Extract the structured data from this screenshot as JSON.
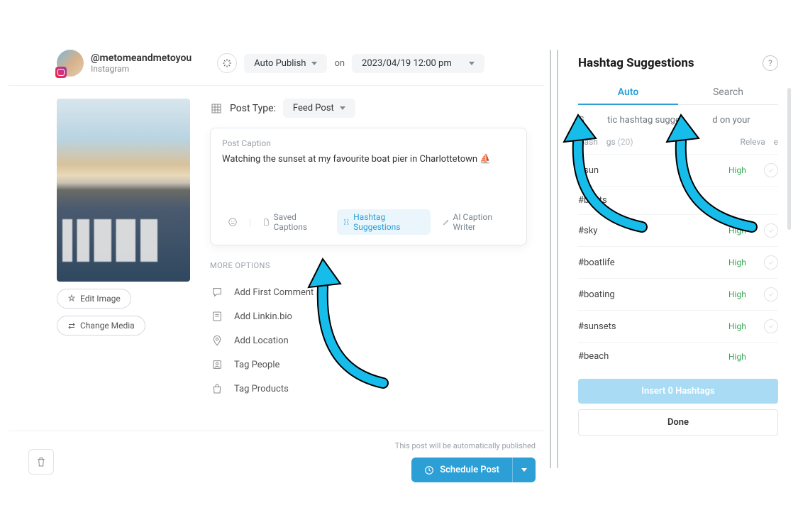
{
  "account": {
    "handle": "@metomeandmetoyou",
    "platform": "Instagram"
  },
  "publish": {
    "mode": "Auto Publish",
    "on": "on",
    "datetime": "2023/04/19 12:00 pm"
  },
  "post_type": {
    "label": "Post Type:",
    "value": "Feed Post"
  },
  "caption": {
    "label": "Post Caption",
    "text": "Watching the sunset at my favourite boat pier in Charlottetown ⛵",
    "tools": {
      "saved": "Saved Captions",
      "hashtag": "Hashtag Suggestions",
      "ai": "AI Caption Writer"
    }
  },
  "more_options_label": "MORE OPTIONS",
  "options": {
    "first_comment": "Add First Comment",
    "linkinbio": "Add Linkin.bio",
    "location": "Add Location",
    "tag_people": "Tag People",
    "tag_products": "Tag Products"
  },
  "media_actions": {
    "edit": "Edit Image",
    "change": "Change Media"
  },
  "footer": {
    "auto_note": "This post will be automatically published",
    "schedule": "Schedule Post"
  },
  "panel": {
    "title": "Hashtag Suggestions",
    "tabs": {
      "auto": "Auto",
      "search": "Search"
    },
    "hint_prefix": "G",
    "hint_mid": "tic hashtag sugges",
    "hint_suffix": "d on your",
    "header": {
      "hashtags": "Hash",
      "hashtags2": "gs",
      "count": "(20)",
      "relevance": "Releva",
      "relevance2": "e"
    },
    "rows": [
      {
        "tag": "#sun",
        "rel": "High",
        "check": true
      },
      {
        "tag": "#boats",
        "rel": "",
        "check": false
      },
      {
        "tag": "#sky",
        "rel": "High",
        "check": true
      },
      {
        "tag": "#boatlife",
        "rel": "High",
        "check": true
      },
      {
        "tag": "#boating",
        "rel": "High",
        "check": true
      },
      {
        "tag": "#sunsets",
        "rel": "High",
        "check": true
      },
      {
        "tag": "#beach",
        "rel": "High",
        "check": false
      }
    ],
    "insert": "Insert 0 Hashtags",
    "done": "Done"
  }
}
